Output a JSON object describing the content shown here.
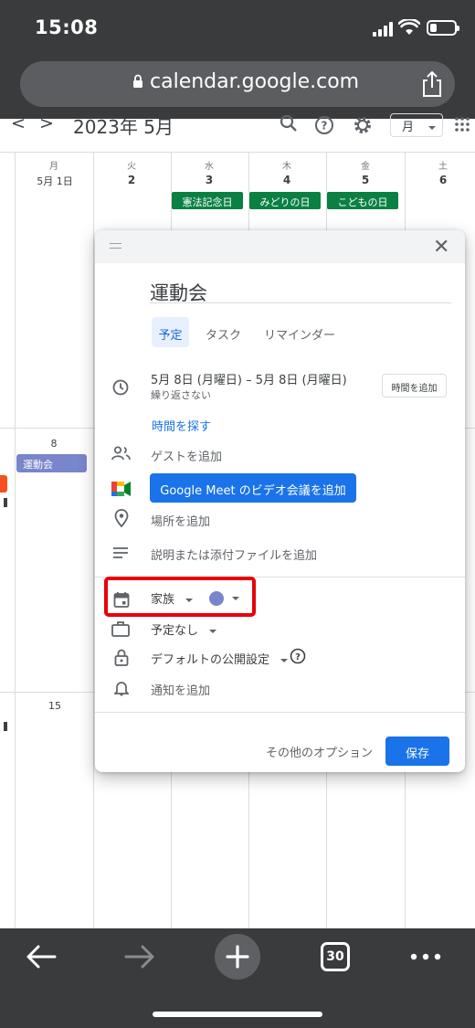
{
  "status_bar": {
    "time": "15:08"
  },
  "browser": {
    "url": "calendar.google.com",
    "tab_count": "30"
  },
  "calendar_header": {
    "prev": "<",
    "next": ">",
    "month_title": "2023年 5月",
    "view": "月"
  },
  "week1": {
    "days": [
      {
        "weekday": "月",
        "date": "5月 1日"
      },
      {
        "weekday": "火",
        "date": "2"
      },
      {
        "weekday": "水",
        "date": "3"
      },
      {
        "weekday": "木",
        "date": "4"
      },
      {
        "weekday": "金",
        "date": "5"
      },
      {
        "weekday": "土",
        "date": "6"
      }
    ],
    "holidays": [
      "憲法記念日",
      "みどりの日",
      "こどもの日"
    ]
  },
  "week2": {
    "date": "8",
    "event": "運動会"
  },
  "week3": {
    "date": "15"
  },
  "dialog": {
    "title": "運動会",
    "tabs": [
      "予定",
      "タスク",
      "リマインダー"
    ],
    "date_range": "5月 8日 (月曜日)  –  5月 8日 (月曜日)",
    "repeat": "繰り返さない",
    "add_time": "時間を追加",
    "find_time": "時間を探す",
    "add_guests": "ゲストを追加",
    "meet_button": "Google Meet のビデオ会議を追加",
    "add_location": "場所を追加",
    "add_description": "説明または添付ファイルを追加",
    "calendar_name": "家族",
    "event_color": "#7986cb",
    "busy_status": "予定なし",
    "visibility": "デフォルトの公開設定",
    "add_notification": "通知を追加",
    "more_options": "その他のオプション",
    "save": "保存"
  },
  "colors": {
    "holiday_green": "#0b8043",
    "accent_blue": "#1a73e8",
    "highlight_red": "#e8000b",
    "browser_dark": "#3a3b3d"
  },
  "icons": [
    "lock-icon",
    "share-icon",
    "search-icon",
    "help-icon",
    "gear-icon",
    "apps-icon",
    "clock-icon",
    "people-icon",
    "meet-icon",
    "location-icon",
    "notes-icon",
    "calendar-icon",
    "briefcase-icon",
    "lock-icon",
    "bell-icon",
    "back-icon",
    "forward-icon",
    "plus-icon",
    "more-icon"
  ]
}
